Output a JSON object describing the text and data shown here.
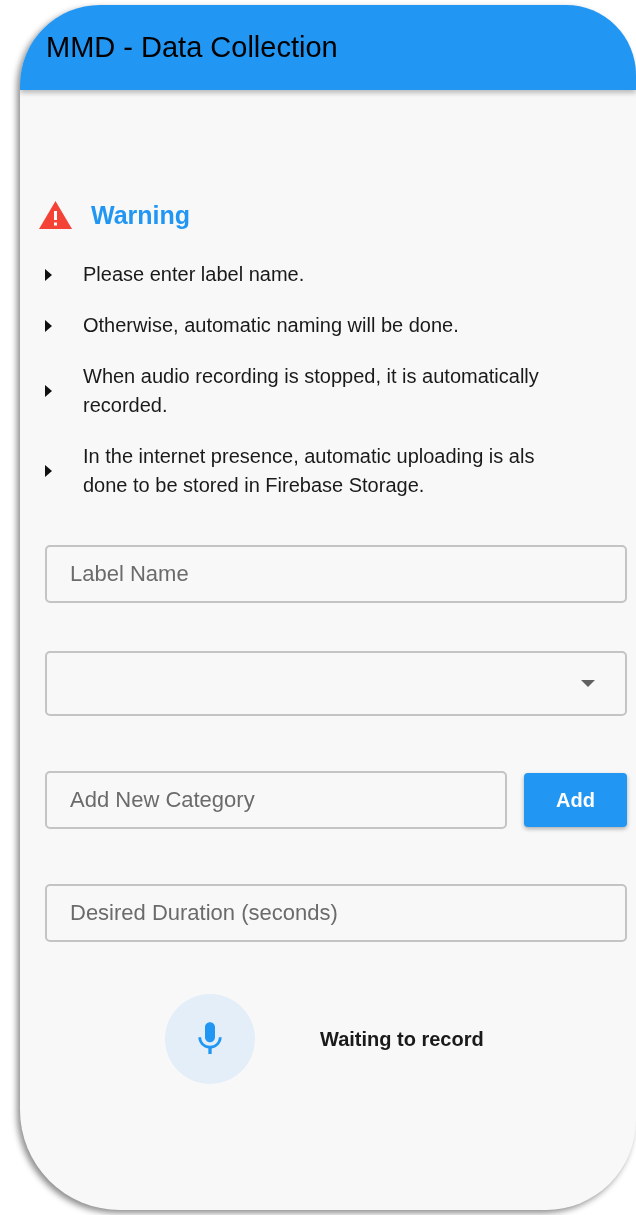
{
  "app_bar": {
    "title": "MMD - Data Collection"
  },
  "warning": {
    "title": "Warning",
    "items": [
      {
        "lines": [
          "Please enter label name."
        ]
      },
      {
        "lines": [
          "Otherwise, automatic naming will be done."
        ]
      },
      {
        "lines": [
          "When audio recording is stopped, it is automatically",
          "recorded."
        ]
      },
      {
        "lines": [
          "In the internet presence, automatic uploading is als",
          "done to be stored in Firebase Storage."
        ]
      }
    ]
  },
  "form": {
    "fields": [
      {
        "kind": "text",
        "placeholder": "Label Name"
      },
      {
        "kind": "dropdown"
      },
      {
        "kind": "text",
        "placeholder": "Add New Category",
        "button": "Add"
      },
      {
        "kind": "text",
        "placeholder": "Desired Duration (seconds)"
      }
    ]
  },
  "recorder": {
    "status": "Waiting to record"
  }
}
